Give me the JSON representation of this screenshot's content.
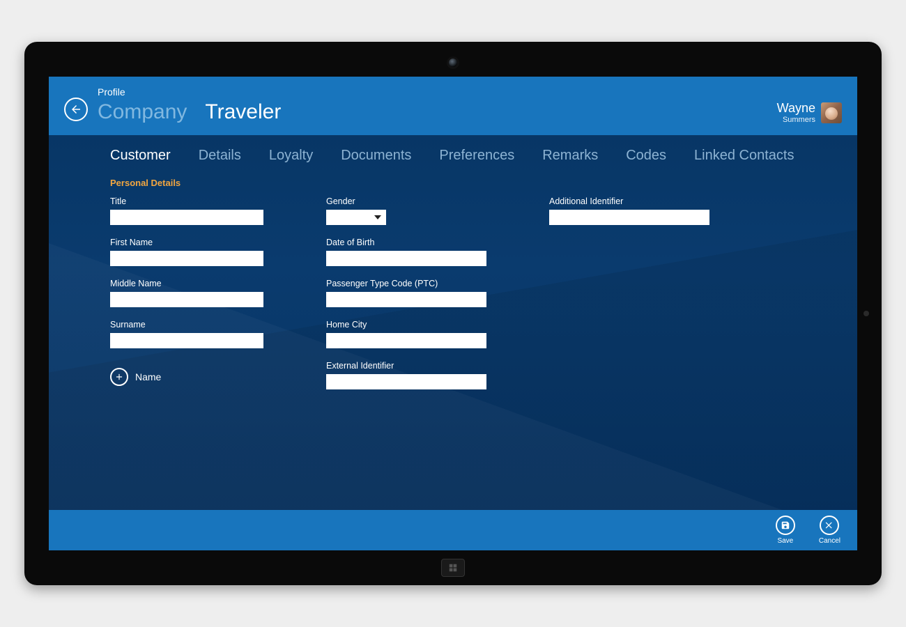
{
  "header": {
    "crumb": "Profile",
    "secondary_title": "Company",
    "primary_title": "Traveler"
  },
  "user": {
    "first": "Wayne",
    "last": "Summers"
  },
  "tabs": {
    "t0": "Customer",
    "t1": "Details",
    "t2": "Loyalty",
    "t3": "Documents",
    "t4": "Preferences",
    "t5": "Remarks",
    "t6": "Codes",
    "t7": "Linked Contacts"
  },
  "section": {
    "personal_details": "Personal Details"
  },
  "labels": {
    "title": "Title",
    "first_name": "First Name",
    "middle_name": "Middle Name",
    "surname": "Surname",
    "add_name": "Name",
    "gender": "Gender",
    "dob": "Date of Birth",
    "ptc": "Passenger Type Code (PTC)",
    "home_city": "Home City",
    "ext_id": "External Identifier",
    "add_id": "Additional Identifier"
  },
  "values": {
    "title": "",
    "first_name": "",
    "middle_name": "",
    "surname": "",
    "gender": "",
    "dob": "",
    "ptc": "",
    "home_city": "",
    "ext_id": "",
    "add_id": ""
  },
  "footer": {
    "save": "Save",
    "cancel": "Cancel"
  }
}
